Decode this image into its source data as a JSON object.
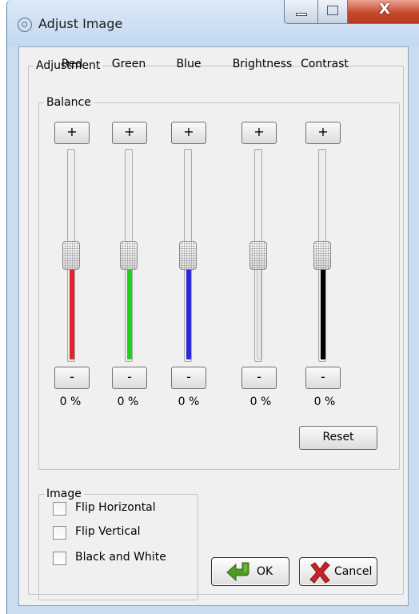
{
  "window": {
    "title": "Adjust Image",
    "close_glyph": "X"
  },
  "adjustment": {
    "legend": "Adjustment",
    "balance": {
      "legend": "Balance",
      "increase_glyph": "+",
      "decrease_glyph": "-",
      "channels": [
        {
          "label": "Red",
          "value_text": "0 %",
          "level": 0.5,
          "fill_color": "#e0262c"
        },
        {
          "label": "Green",
          "value_text": "0 %",
          "level": 0.5,
          "fill_color": "#1ed31e"
        },
        {
          "label": "Blue",
          "value_text": "0 %",
          "level": 0.5,
          "fill_color": "#2a2ad4"
        },
        {
          "label": "Brightness",
          "value_text": "0 %",
          "level": 0.5,
          "fill_color": "#e8e8e8"
        },
        {
          "label": "Contrast",
          "value_text": "0 %",
          "level": 0.5,
          "fill_color": "#000000"
        }
      ],
      "reset_label": "Reset"
    },
    "image": {
      "legend": "Image",
      "options": [
        {
          "label": "Flip Horizontal",
          "checked": false
        },
        {
          "label": "Flip Vertical",
          "checked": false
        },
        {
          "label": "Black and White",
          "checked": false
        }
      ]
    }
  },
  "buttons": {
    "ok_label": "OK",
    "ok_icon": "green-arrow-icon",
    "cancel_label": "Cancel",
    "cancel_icon": "red-x-icon"
  }
}
